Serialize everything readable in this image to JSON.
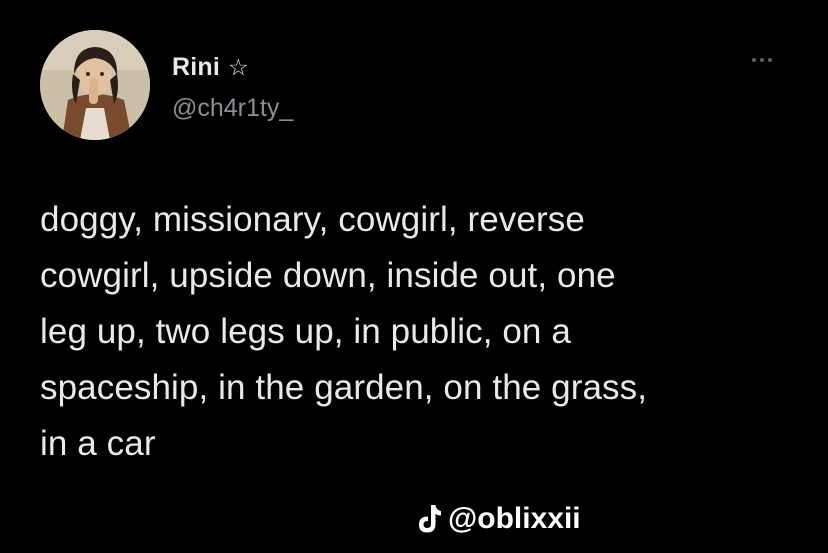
{
  "user": {
    "display_name": "Rini",
    "badge_icon": "star-outline-icon",
    "badge_glyph": "☆",
    "handle": "@ch4r1ty_"
  },
  "tweet": {
    "lines": [
      "doggy, missionary, cowgirl, reverse",
      "cowgirl, upside down, inside out, one",
      "leg up, two legs up, in public, on a",
      "spaceship, in the garden, on the grass,",
      "in a car"
    ]
  },
  "menu": {
    "icon": "more-options-icon"
  },
  "watermark": {
    "icon": "tiktok-logo-icon",
    "text": "@oblixxii"
  },
  "colors": {
    "background": "#000000",
    "text": "#e7e9ea",
    "secondary_text": "#8b8f94"
  }
}
